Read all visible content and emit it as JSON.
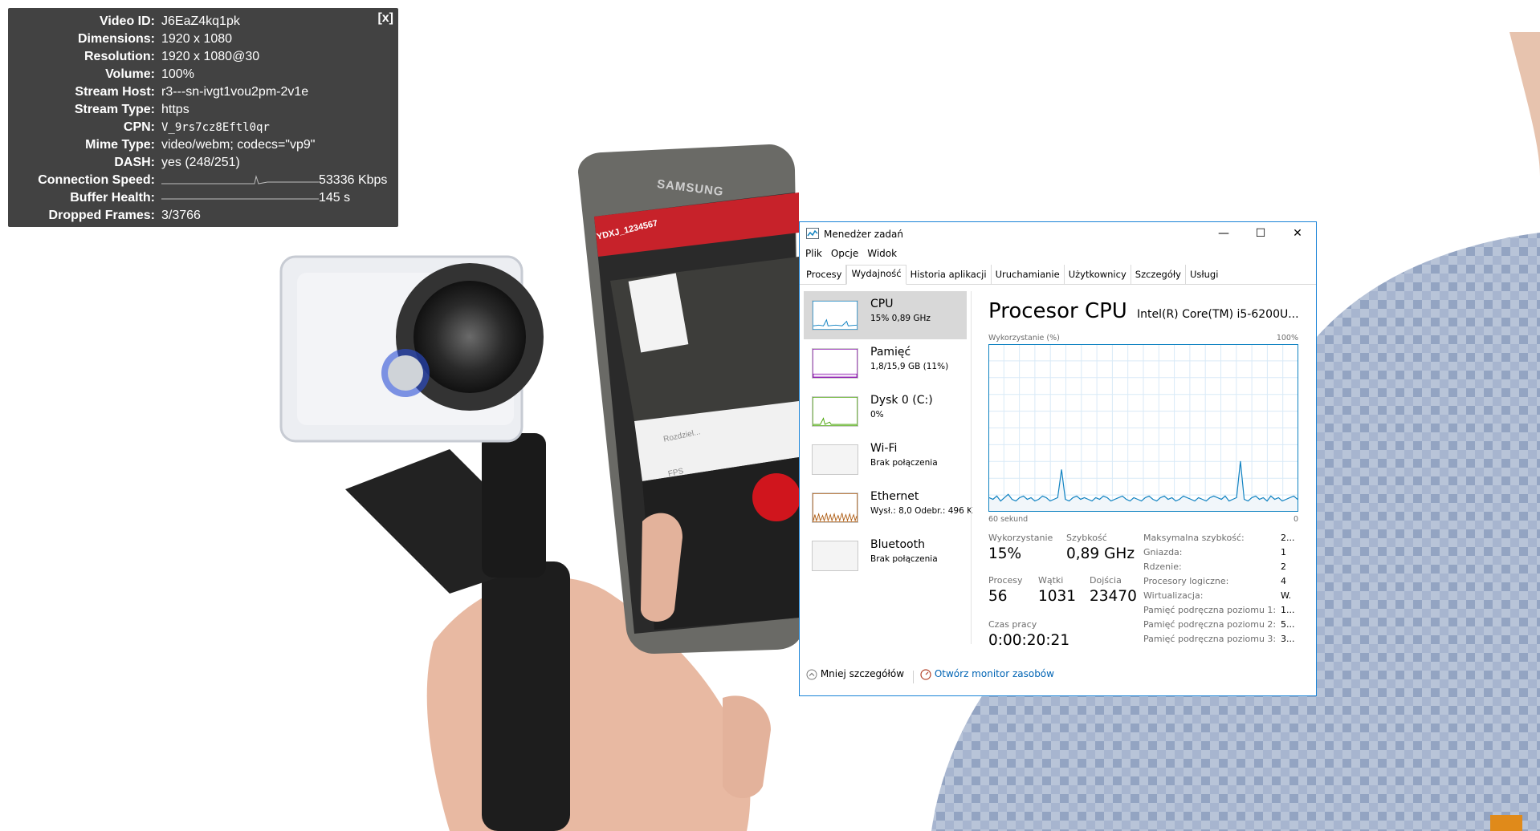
{
  "stats": {
    "close_label": "[x]",
    "rows": [
      {
        "key": "Video ID:",
        "value": "J6EaZ4kq1pk"
      },
      {
        "key": "Dimensions:",
        "value": "1920 x 1080"
      },
      {
        "key": "Resolution:",
        "value": "1920 x 1080@30"
      },
      {
        "key": "Volume:",
        "value": "100%"
      },
      {
        "key": "Stream Host:",
        "value": "r3---sn-ivgt1vou2pm-2v1e"
      },
      {
        "key": "Stream Type:",
        "value": "https"
      },
      {
        "key": "CPN:",
        "value": "V_9rs7cz8Eftl0qr"
      },
      {
        "key": "Mime Type:",
        "value": "video/webm; codecs=\"vp9\""
      },
      {
        "key": "DASH:",
        "value": "yes (248/251)"
      },
      {
        "key": "Connection Speed:",
        "value": "53336 Kbps"
      },
      {
        "key": "Buffer Health:",
        "value": "145 s"
      },
      {
        "key": "Dropped Frames:",
        "value": "3/3766"
      }
    ]
  },
  "phone": {
    "brand": "SAMSUNG",
    "app_title": "YDXJ_1234567",
    "label_resolution": "Rozdziel...",
    "label_fps": "FPS"
  },
  "taskmanager": {
    "title": "Menedżer zadań",
    "controls": {
      "minimize": "—",
      "maximize": "☐",
      "close": "✕"
    },
    "menu": [
      "Plik",
      "Opcje",
      "Widok"
    ],
    "tabs": [
      "Procesy",
      "Wydajność",
      "Historia aplikacji",
      "Uruchamianie",
      "Użytkownicy",
      "Szczegóły",
      "Usługi"
    ],
    "active_tab": "Wydajność",
    "resources": [
      {
        "name": "CPU",
        "sub": "15% 0,89 GHz",
        "color": "#1183c2"
      },
      {
        "name": "Pamięć",
        "sub": "1,8/15,9 GB (11%)",
        "color": "#8b12ae"
      },
      {
        "name": "Dysk 0 (C:)",
        "sub": "0%",
        "color": "#4da60c"
      },
      {
        "name": "Wi-Fi",
        "sub": "Brak połączenia",
        "color": "#c9c9c9"
      },
      {
        "name": "Ethernet",
        "sub": "Wysł.: 8,0  Odebr.: 496 K",
        "color": "#a74f01"
      },
      {
        "name": "Bluetooth",
        "sub": "Brak połączenia",
        "color": "#c9c9c9"
      }
    ],
    "detail": {
      "heading": "Procesor CPU",
      "processor": "Intel(R) Core(TM) i5-6200U...",
      "usage_axis_label": "Wykorzystanie (%)",
      "axis_max": "100%",
      "axis_time": "60 sekund",
      "axis_min": "0",
      "cpu_history": [
        8,
        7,
        9,
        6,
        8,
        10,
        7,
        6,
        8,
        9,
        7,
        8,
        6,
        7,
        9,
        8,
        6,
        7,
        8,
        25,
        7,
        6,
        8,
        9,
        7,
        8,
        7,
        6,
        8,
        7,
        9,
        8,
        6,
        7,
        8,
        9,
        7,
        6,
        8,
        7,
        6,
        8,
        9,
        7,
        6,
        8,
        9,
        7,
        8,
        6,
        7,
        9,
        8,
        7,
        6,
        8,
        7,
        6,
        8,
        9,
        8,
        7,
        9,
        6,
        7,
        8,
        30,
        7,
        6,
        8,
        9,
        7,
        8,
        6,
        9,
        7,
        8,
        6,
        7,
        8,
        9,
        7
      ],
      "stats": {
        "usage_label": "Wykorzystanie",
        "usage_value": "15%",
        "speed_label": "Szybkość",
        "speed_value": "0,89 GHz",
        "processes_label": "Procesy",
        "processes_value": "56",
        "threads_label": "Wątki",
        "threads_value": "1031",
        "handles_label": "Dojścia",
        "handles_value": "23470",
        "uptime_label": "Czas pracy",
        "uptime_value": "0:00:20:21"
      },
      "specs": [
        {
          "k": "Maksymalna szybkość:",
          "v": "2..."
        },
        {
          "k": "Gniazda:",
          "v": "1"
        },
        {
          "k": "Rdzenie:",
          "v": "2"
        },
        {
          "k": "Procesory logiczne:",
          "v": "4"
        },
        {
          "k": "Wirtualizacja:",
          "v": "W."
        },
        {
          "k": "Pamięć podręczna poziomu 1:",
          "v": "1..."
        },
        {
          "k": "Pamięć podręczna poziomu 2:",
          "v": "5..."
        },
        {
          "k": "Pamięć podręczna poziomu 3:",
          "v": "3..."
        }
      ]
    },
    "fewer_details": "Mniej szczegółów",
    "resource_monitor": "Otwórz monitor zasobów"
  },
  "colors": {
    "cpu_blue": "#1183c2",
    "cpu_fill": "#f1f6fa",
    "accent_border": "#1883d7",
    "link_blue": "#0064b4"
  }
}
